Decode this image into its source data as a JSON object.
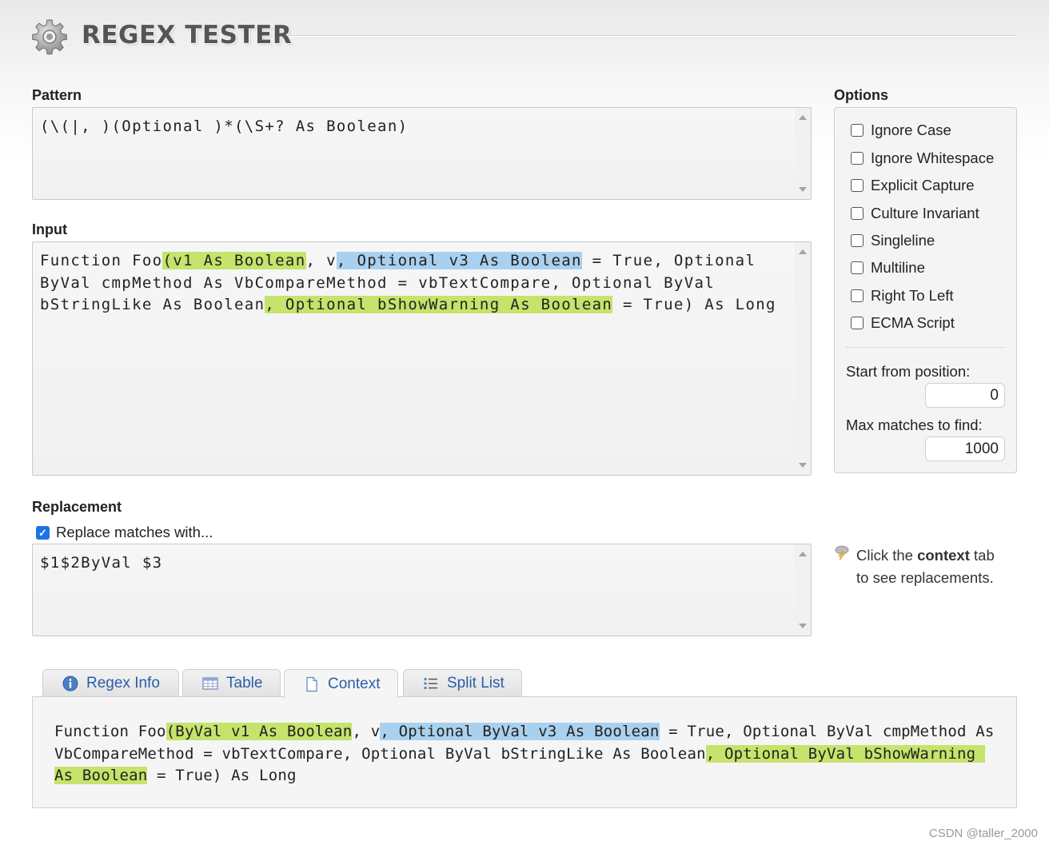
{
  "app": {
    "title": "REGEX TESTER",
    "logo_icon": "gear-icon"
  },
  "pattern": {
    "label": "Pattern",
    "value": "(\\(|, )(Optional )*(\\S+? As Boolean)"
  },
  "input": {
    "label": "Input",
    "segments": [
      {
        "text": "Function Foo",
        "hl": ""
      },
      {
        "text": "(v1 As Boolean",
        "hl": "g"
      },
      {
        "text": ", v",
        "hl": ""
      },
      {
        "text": ", Optional v3 As Boolean",
        "hl": "b"
      },
      {
        "text": " = True, Optional ByVal cmpMethod As VbCompareMethod = vbTextCompare, Optional ByVal bStringLike As Boolean",
        "hl": ""
      },
      {
        "text": ", Optional bShowWarning As Boolean",
        "hl": "g"
      },
      {
        "text": " = True) As Long",
        "hl": ""
      }
    ]
  },
  "options": {
    "label": "Options",
    "items": [
      {
        "label": "Ignore Case",
        "checked": false
      },
      {
        "label": "Ignore Whitespace",
        "checked": false
      },
      {
        "label": "Explicit Capture",
        "checked": false
      },
      {
        "label": "Culture Invariant",
        "checked": false
      },
      {
        "label": "Singleline",
        "checked": false
      },
      {
        "label": "Multiline",
        "checked": false
      },
      {
        "label": "Right To Left",
        "checked": false
      },
      {
        "label": "ECMA Script",
        "checked": false
      }
    ],
    "start_label": "Start from position:",
    "start_value": "0",
    "max_label": "Max matches to find:",
    "max_value": "1000"
  },
  "replacement": {
    "label": "Replacement",
    "checkbox_label": "Replace matches with...",
    "checked": true,
    "value": "$1$2ByVal $3"
  },
  "tip": {
    "icon": "lightning-cloud-icon",
    "prefix": "Click the ",
    "bold": "context",
    "suffix": " tab",
    "line2": "to see replacements."
  },
  "tabs": [
    {
      "label": "Regex Info",
      "icon": "info-icon",
      "active": false
    },
    {
      "label": "Table",
      "icon": "table-icon",
      "active": false
    },
    {
      "label": "Context",
      "icon": "document-icon",
      "active": true
    },
    {
      "label": "Split List",
      "icon": "list-icon",
      "active": false
    }
  ],
  "context": {
    "segments": [
      {
        "text": "Function Foo",
        "hl": ""
      },
      {
        "text": "(ByVal v1 As Boolean",
        "hl": "g"
      },
      {
        "text": ", v",
        "hl": ""
      },
      {
        "text": ", Optional ByVal v3 As Boolean",
        "hl": "b"
      },
      {
        "text": " = True, Optional ByVal cmpMethod As VbCompareMethod = vbTextCompare, Optional ByVal bStringLike As Boolean",
        "hl": ""
      },
      {
        "text": ", Optional ByVal bShowWarning As Boolean",
        "hl": "g"
      },
      {
        "text": " = True) As Long",
        "hl": ""
      }
    ]
  },
  "watermark": "CSDN @taller_2000",
  "colors": {
    "match_green": "#c6e36b",
    "match_blue": "#a9d1ef",
    "link_blue": "#2a5da8",
    "checkbox_blue": "#1a73e8"
  }
}
